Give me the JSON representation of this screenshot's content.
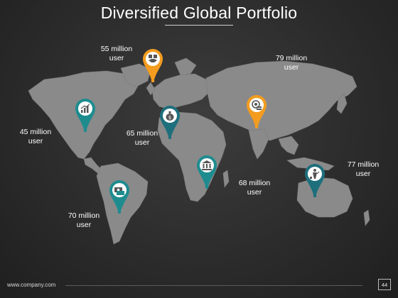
{
  "slide": {
    "title": "Diversified Global Portfolio",
    "footer": "www.company.com",
    "page_number": "44"
  },
  "colors": {
    "orange": "#F39C1F",
    "teal": "#1E8C8F",
    "map_fill": "#8A8A8A",
    "background": "#2B2B2B"
  },
  "markers": [
    {
      "id": "north-america",
      "label": "45 million\nuser",
      "color": "teal",
      "icon": "chart-icon"
    },
    {
      "id": "south-america",
      "label": "70 million\nuser",
      "color": "teal",
      "icon": "cash-icon"
    },
    {
      "id": "europe",
      "label": "55 million\nuser",
      "color": "orange",
      "icon": "handshake-icon"
    },
    {
      "id": "africa-west",
      "label": "65 million\nuser",
      "color": "teal",
      "icon": "money-bag-icon"
    },
    {
      "id": "africa-south",
      "label": "68 million\nuser",
      "color": "teal",
      "icon": "bank-icon"
    },
    {
      "id": "asia",
      "label": "79 million\nuser",
      "color": "orange",
      "icon": "coin-gear-icon"
    },
    {
      "id": "oceania",
      "label": "77 million\nuser",
      "color": "teal",
      "icon": "investor-icon"
    }
  ]
}
